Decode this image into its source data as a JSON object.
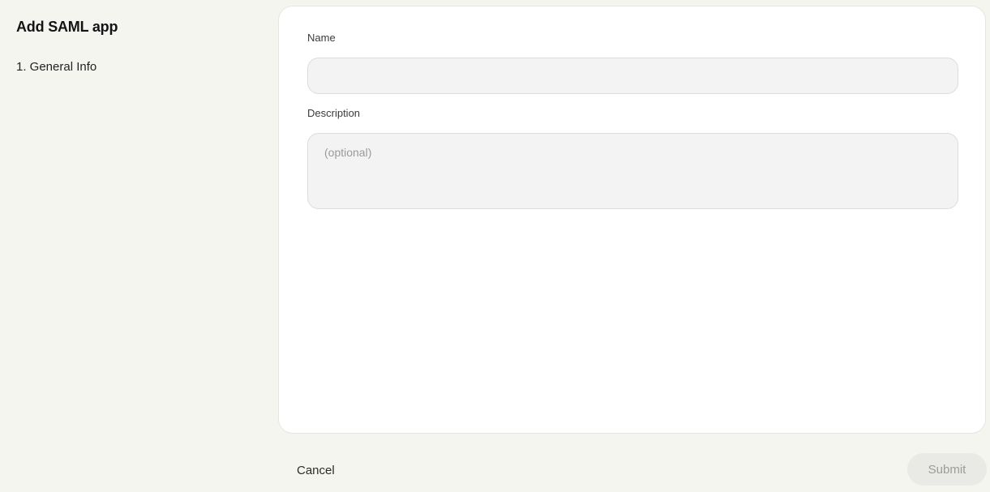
{
  "sidebar": {
    "title": "Add SAML app",
    "steps": [
      {
        "label": "1. General Info"
      }
    ]
  },
  "form": {
    "name": {
      "label": "Name",
      "value": "",
      "placeholder": ""
    },
    "description": {
      "label": "Description",
      "value": "",
      "placeholder": "(optional)"
    }
  },
  "footer": {
    "cancel_label": "Cancel",
    "submit_label": "Submit"
  }
}
